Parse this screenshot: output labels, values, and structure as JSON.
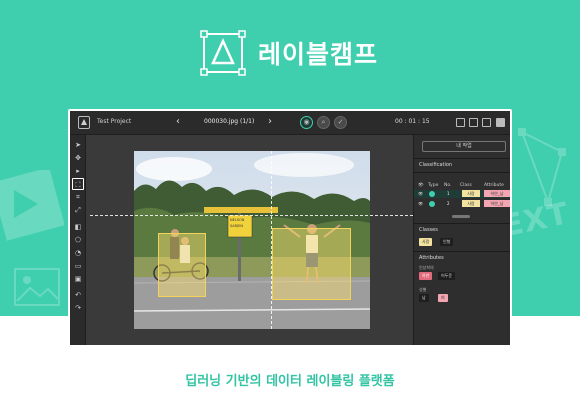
{
  "brand": {
    "name": "레이블캠프",
    "tagline": "딥러닝 기반의 데이터 레이블링 플랫폼",
    "accent_color": "#3fcfae",
    "deco_text": "TEXT"
  },
  "app": {
    "project_name": "Test Project",
    "file_name": "000030.jpg (1/1)",
    "prev_icon": "chevron-left-icon",
    "next_icon": "chevron-right-icon",
    "timer": "00 : 01 : 15",
    "left_tools": [
      "pointer-icon",
      "move-icon",
      "select-icon",
      "bbox-icon",
      "crop-icon",
      "expand-icon",
      "fill-icon",
      "polygon-icon",
      "tag-icon",
      "comment-icon",
      "image-icon",
      "undo-icon",
      "redo-icon"
    ]
  },
  "panel": {
    "my_work_button": "내 작업",
    "classification": {
      "title": "Classification",
      "headers": [
        "Type",
        "No.",
        "Class",
        "Attribute"
      ],
      "rows": [
        {
          "no": "1",
          "class": "사람",
          "attribute": "하얀_남"
        },
        {
          "no": "2",
          "class": "사람",
          "attribute": "하얀_남"
        }
      ]
    },
    "classes": {
      "title": "Classes",
      "items": [
        "사람",
        "인형"
      ]
    },
    "attributes": {
      "title": "Attributes",
      "groups": [
        {
          "label": "인상착의",
          "options": [
            "하얀",
            "어두운"
          ]
        },
        {
          "label": "성별",
          "options": [
            "남",
            "여"
          ]
        }
      ]
    }
  }
}
